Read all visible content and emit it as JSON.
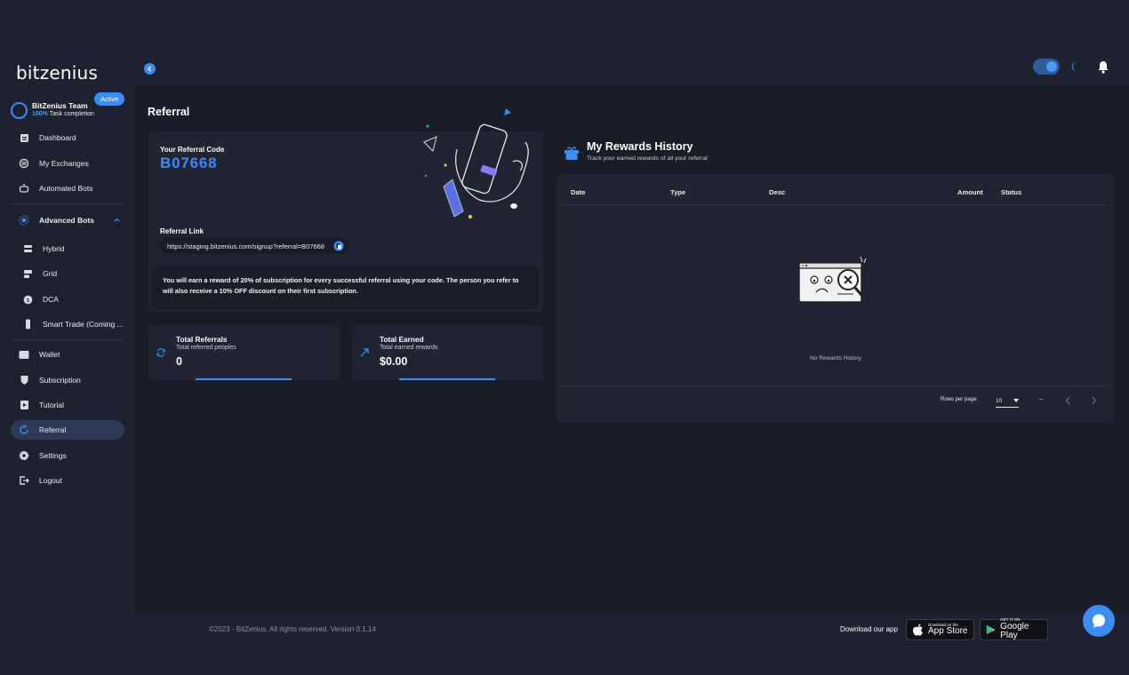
{
  "brand": {
    "logo_text": "bitzenius"
  },
  "topbar": {
    "theme_toggle_on": true
  },
  "team": {
    "name": "BitZenius Team",
    "percent": "100%",
    "completion_label": "Task completion",
    "badge": "Active"
  },
  "sidebar": {
    "items": [
      {
        "label": "Dashboard",
        "icon": "dashboard-icon"
      },
      {
        "label": "My Exchanges",
        "icon": "exchange-icon"
      },
      {
        "label": "Automated Bots",
        "icon": "robot-icon"
      },
      {
        "label": "Advanced Bots",
        "icon": "advanced-bots-icon"
      },
      {
        "label": "Hybrid",
        "icon": "hybrid-icon"
      },
      {
        "label": "Grid",
        "icon": "grid-icon"
      },
      {
        "label": "DCA",
        "icon": "dca-icon"
      },
      {
        "label": "Smart Trade (Coming ...",
        "icon": "smart-trade-icon"
      },
      {
        "label": "Wallet",
        "icon": "wallet-icon"
      },
      {
        "label": "Subscription",
        "icon": "subscription-icon"
      },
      {
        "label": "Tutorial",
        "icon": "tutorial-icon"
      },
      {
        "label": "Referral",
        "icon": "referral-icon"
      },
      {
        "label": "Settings",
        "icon": "settings-icon"
      },
      {
        "label": "Logout",
        "icon": "logout-icon"
      }
    ],
    "active": "Referral"
  },
  "page": {
    "title": "Referral"
  },
  "referral": {
    "code_label": "Your Referral Code",
    "code": "B07668",
    "link_label": "Referral Link",
    "link": "https://staging.bitzenius.com/signup?referral=B07668",
    "note": "You will earn a reward of 20% of subscription for every successful referral using your code. The person you refer to will also receive a 10% OFF discount on their first subscription."
  },
  "stats": {
    "referrals": {
      "title": "Total Referrals",
      "subtitle": "Total referred peoples",
      "value": "0"
    },
    "earned": {
      "title": "Total Earned",
      "subtitle": "Total earned rewards",
      "value": "$0.00"
    }
  },
  "rewards": {
    "title": "My Rewards History",
    "subtitle": "Track your earned rewards of all your referral",
    "columns": [
      "Date",
      "Type",
      "Desc",
      "Amount",
      "Status"
    ],
    "empty_text": "No Rewards History",
    "rows_per_page_label": "Rows per page:",
    "rows_per_page": "10",
    "range": "–"
  },
  "footer": {
    "copyright": "©2023 - BitZenius. All rights reserved. Version 0.1.14",
    "download_label": "Download our app",
    "appstore_small": "Download on the",
    "appstore_big": "App Store",
    "gplay_small": "GET IT ON",
    "gplay_big": "Google Play"
  },
  "colors": {
    "accent": "#3b8cf5",
    "background": "#1e2230",
    "card": "#212533"
  }
}
